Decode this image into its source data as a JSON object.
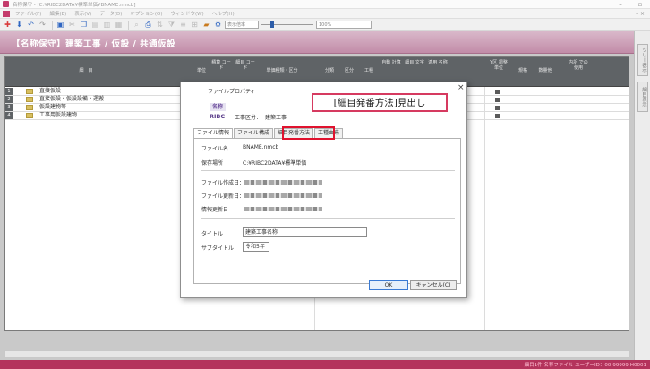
{
  "window": {
    "title": "名称保守 - [C:¥RIBC2DATA¥標準単価¥BNAME.nmcb]",
    "minimize": "–",
    "restore": "▫"
  },
  "menu": {
    "items": [
      "ファイル(F)",
      "編集(E)",
      "表示(V)",
      "データ(D)",
      "オプション(O)",
      "ウィンドウ(W)",
      "ヘルプ(H)"
    ],
    "right_mark": "– ×"
  },
  "toolbar": {
    "combo_mode": "表示倍率",
    "zoom": "100%"
  },
  "header": {
    "title": "【名称保守】建築工事 / 仮設 / 共通仮設"
  },
  "right_panel": {
    "tab1": "ツリー表示",
    "tab2": "細目表示"
  },
  "grid": {
    "columns": [
      {
        "label": "細　目"
      },
      {
        "label": "単位"
      },
      {
        "label": "積算 コード"
      },
      {
        "label": "細目 コード"
      },
      {
        "label": "単価種類・区分"
      },
      {
        "label": "分類"
      },
      {
        "label": "区分"
      },
      {
        "label": "工種"
      },
      {
        "label": "自動 計算"
      },
      {
        "label": "細目 文字"
      },
      {
        "label": "適用 名称"
      },
      {
        "label": "Y区 調整 単位"
      },
      {
        "label": "規格"
      },
      {
        "label": "数量他"
      },
      {
        "label": "内訳 での 使用"
      }
    ],
    "rows": [
      {
        "num": "1",
        "name": "直接仮設"
      },
      {
        "num": "2",
        "name": "直接仮設・仮設設備・運搬"
      },
      {
        "num": "3",
        "name": "仮設建物等"
      },
      {
        "num": "4",
        "name": "工事用仮設建物"
      }
    ]
  },
  "dialog": {
    "title": "ファイルプロパティ",
    "close": "×",
    "logo_top": "名称",
    "logo_bottom": "RIBC",
    "kubun_label": "工事区分：",
    "kubun_value": "建築工事",
    "tabs": [
      "ファイル情報",
      "ファイル構成",
      "細目発番方法",
      "工種由来"
    ],
    "fields": {
      "filename_label": "ファイル名",
      "filename_value": "BNAME.nmcb",
      "location_label": "保存場所",
      "location_value": "C:¥RIBC2DATA¥標準単価",
      "created_label": "ファイル作成日：",
      "modified_label": "ファイル更新日：",
      "data_updated_label": "情報更新日",
      "title_label": "タイトル",
      "title_value": "建築工事名称",
      "subtitle_label": "サブタイトル：",
      "subtitle_value": "令和5年"
    },
    "colon": "：",
    "ok": "OK",
    "cancel": "キャンセル(C)"
  },
  "callout": {
    "text": "[細目発番方法]見出し"
  },
  "status": {
    "text": "細目1件 名称ファイル ユーザーID：00-99999-H0001"
  },
  "colors": {
    "accent_pink": "#b4335c",
    "header_band": "#c28ca8",
    "grid_header": "#5f6366",
    "highlight_red": "#e0122e"
  }
}
